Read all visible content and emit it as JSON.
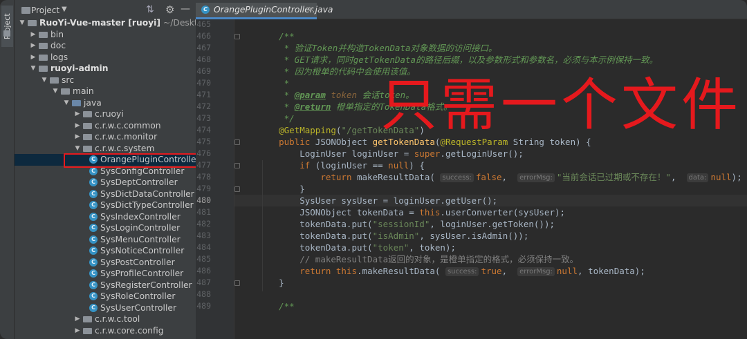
{
  "sidebar_strip": {
    "label": "Project"
  },
  "project_panel": {
    "title": "Project",
    "tree": [
      {
        "indent": 0,
        "arrow": "▼",
        "icon": "folder",
        "label": "RuoYi-Vue-master [ruoyi]",
        "suffix": " ~/Desktop/M",
        "bold": true
      },
      {
        "indent": 1,
        "arrow": "▶",
        "icon": "folder",
        "label": "bin"
      },
      {
        "indent": 1,
        "arrow": "▶",
        "icon": "folder",
        "label": "doc"
      },
      {
        "indent": 1,
        "arrow": "▶",
        "icon": "folder",
        "label": "logs"
      },
      {
        "indent": 1,
        "arrow": "▼",
        "icon": "folder",
        "label": "ruoyi-admin",
        "bold": true
      },
      {
        "indent": 2,
        "arrow": "▼",
        "icon": "folder",
        "label": "src"
      },
      {
        "indent": 3,
        "arrow": "▼",
        "icon": "folder",
        "label": "main"
      },
      {
        "indent": 4,
        "arrow": "▼",
        "icon": "src",
        "label": "java"
      },
      {
        "indent": 5,
        "arrow": "▶",
        "icon": "pkg",
        "label": "c.ruoyi"
      },
      {
        "indent": 5,
        "arrow": "▶",
        "icon": "pkg",
        "label": "c.r.w.c.common"
      },
      {
        "indent": 5,
        "arrow": "▶",
        "icon": "pkg",
        "label": "c.r.w.c.monitor"
      },
      {
        "indent": 5,
        "arrow": "▼",
        "icon": "pkg",
        "label": "c.r.w.c.system"
      },
      {
        "indent": 6,
        "arrow": "",
        "icon": "class",
        "label": "OrangePluginController",
        "selected": true
      },
      {
        "indent": 6,
        "arrow": "",
        "icon": "class",
        "label": "SysConfigController"
      },
      {
        "indent": 6,
        "arrow": "",
        "icon": "class",
        "label": "SysDeptController"
      },
      {
        "indent": 6,
        "arrow": "",
        "icon": "class",
        "label": "SysDictDataController"
      },
      {
        "indent": 6,
        "arrow": "",
        "icon": "class",
        "label": "SysDictTypeController"
      },
      {
        "indent": 6,
        "arrow": "",
        "icon": "class",
        "label": "SysIndexController"
      },
      {
        "indent": 6,
        "arrow": "",
        "icon": "class",
        "label": "SysLoginController"
      },
      {
        "indent": 6,
        "arrow": "",
        "icon": "class",
        "label": "SysMenuController"
      },
      {
        "indent": 6,
        "arrow": "",
        "icon": "class",
        "label": "SysNoticeController"
      },
      {
        "indent": 6,
        "arrow": "",
        "icon": "class",
        "label": "SysPostController"
      },
      {
        "indent": 6,
        "arrow": "",
        "icon": "class",
        "label": "SysProfileController"
      },
      {
        "indent": 6,
        "arrow": "",
        "icon": "class",
        "label": "SysRegisterController"
      },
      {
        "indent": 6,
        "arrow": "",
        "icon": "class",
        "label": "SysRoleController"
      },
      {
        "indent": 6,
        "arrow": "",
        "icon": "class",
        "label": "SysUserController"
      },
      {
        "indent": 5,
        "arrow": "▶",
        "icon": "pkg",
        "label": "c.r.w.c.tool"
      },
      {
        "indent": 5,
        "arrow": "▶",
        "icon": "pkg",
        "label": "c.r.w.core.config"
      }
    ]
  },
  "editor": {
    "tab_label": "OrangePluginController.java",
    "current_line": 480,
    "lines": [
      {
        "n": 465,
        "html": ""
      },
      {
        "n": 466,
        "html": "    <span class='d'>/**</span>"
      },
      {
        "n": 467,
        "html": "    <span class='d'> * 验证Token并构造TokenData对象数据的访问接口。</span>"
      },
      {
        "n": 468,
        "html": "    <span class='d'> * GET请求，同时getTokenData的路径后缀，以及参数形式和参数名，必须与本示例保持一致。</span>"
      },
      {
        "n": 469,
        "html": "    <span class='d'> * 因为橙单的代码中会使用该值。</span>"
      },
      {
        "n": 470,
        "html": "    <span class='d'> *</span>"
      },
      {
        "n": 471,
        "html": "    <span class='d'> * </span><span class='dtag'>@param</span><span class='d'> </span><span class='dparam'>token</span><span class='d'> 会话token。</span>"
      },
      {
        "n": 472,
        "html": "    <span class='d'> * </span><span class='dtag'>@return</span><span class='d'> 橙单指定的TokenData格式。</span>"
      },
      {
        "n": 473,
        "html": "    <span class='d'> */</span>"
      },
      {
        "n": 474,
        "html": "    <span class='a'>@GetMapping</span>(<span class='s'>\"/getTokenData\"</span>)"
      },
      {
        "n": 475,
        "html": "    <span class='k'>public</span> JSONObject <span class='f'>getTokenData</span>(<span class='a'>@RequestParam</span> String token) {"
      },
      {
        "n": 476,
        "html": "        LoginUser loginUser = <span class='k'>super</span>.getLoginUser();"
      },
      {
        "n": 477,
        "html": "        <span class='k'>if</span> (loginUser == <span class='k'>null</span>) {"
      },
      {
        "n": 478,
        "html": "            <span class='k'>return</span> makeResultData( <span class='hint'>success:</span><span class='k'>false</span>,  <span class='hint'>errorMsg:</span><span class='s'>\"当前会话已过期或不存在！\"</span>,  <span class='hint'>data:</span><span class='k'>null</span>);"
      },
      {
        "n": 479,
        "html": "        }"
      },
      {
        "n": 480,
        "html": "        SysUser sysUser = loginUser.getUser();"
      },
      {
        "n": 481,
        "html": "        JSONObject tokenData = <span class='k'>this</span>.userConverter(sysUser);"
      },
      {
        "n": 482,
        "html": "        tokenData.put(<span class='s'>\"sessionId\"</span>, loginUser.getToken());"
      },
      {
        "n": 483,
        "html": "        tokenData.put(<span class='s'>\"isAdmin\"</span>, sysUser.isAdmin());"
      },
      {
        "n": 484,
        "html": "        tokenData.put(<span class='s'>\"token\"</span>, token);"
      },
      {
        "n": 485,
        "html": "        <span class='cm'>// makeResultData返回的对象，是橙单指定的格式，必须保持一致。</span>"
      },
      {
        "n": 486,
        "html": "        <span class='k'>return</span> <span class='k'>this</span>.makeResultData( <span class='hint'>success:</span><span class='k'>true</span>,  <span class='hint'>errorMsg:</span><span class='k'>null</span>, tokenData);"
      },
      {
        "n": 487,
        "html": "    }"
      },
      {
        "n": 488,
        "html": ""
      },
      {
        "n": 489,
        "html": "    <span class='d'>/**</span>"
      }
    ]
  },
  "overlay": {
    "text": "只需一个文件",
    "color": "#e5191d"
  },
  "colors": {
    "accent": "#4a88c7",
    "highlight_box": "#e5191d",
    "class_icon": "#3592c4"
  }
}
